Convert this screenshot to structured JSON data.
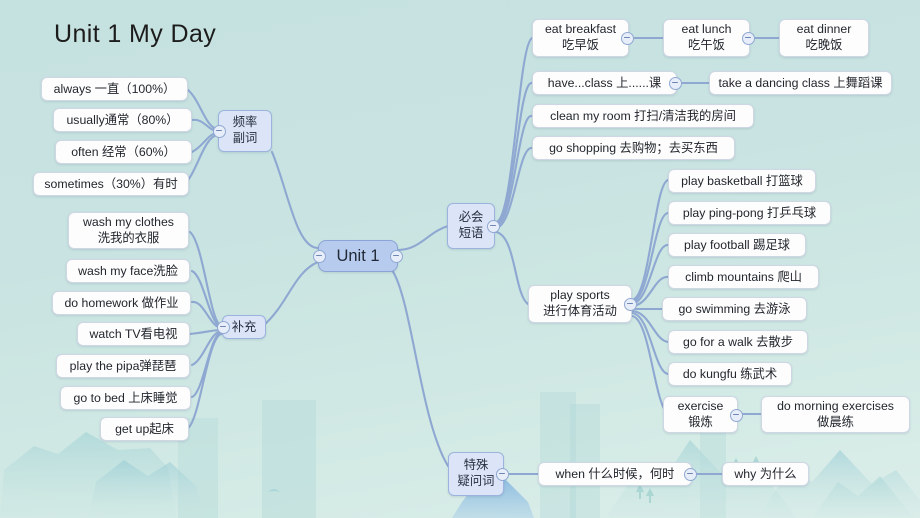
{
  "page": {
    "title": "Unit 1  My Day",
    "background_color": "#c6e2e0",
    "node_fill": "#fdfdfd",
    "branch_fill": "#dbe5f7",
    "root_fill": "#b7cbee",
    "connector_color": "#8fa8d2"
  },
  "root": {
    "label": "Unit 1"
  },
  "branches": {
    "frequency_adverbs": {
      "label_line1": "频率",
      "label_line2": "副词",
      "children": [
        {
          "text": "always  一直（100%）"
        },
        {
          "text": "usually通常（80%）"
        },
        {
          "text": "often 经常（60%）"
        },
        {
          "text": "sometimes（30%）有时"
        }
      ]
    },
    "supplement": {
      "label": "补充",
      "children": [
        {
          "line1": "wash my clothes",
          "line2": "洗我的衣服"
        },
        {
          "text": "wash my face洗脸"
        },
        {
          "text": "do homework 做作业"
        },
        {
          "text": "watch TV看电视"
        },
        {
          "text": "play the pipa弹琵琶"
        },
        {
          "text": "go to bed 上床睡觉"
        },
        {
          "text": "get  up起床"
        }
      ]
    },
    "must_know_phrases": {
      "label_line1": "必会",
      "label_line2": "短语",
      "children": [
        {
          "line1": "eat breakfast",
          "line2": "吃早饭",
          "sibling1": {
            "line1": "eat  lunch",
            "line2": "吃午饭"
          },
          "sibling2": {
            "line1": "eat dinner",
            "line2": "吃晚饭"
          }
        },
        {
          "text": "have...class 上......课",
          "sibling1": {
            "text": "take a dancing class 上舞蹈课"
          }
        },
        {
          "text": "clean my room 打扫/清洁我的房间"
        },
        {
          "text": "go shopping 去购物；去买东西"
        }
      ],
      "play_sports": {
        "line1": "play sports",
        "line2": "进行体育活动",
        "children": [
          {
            "text": "play  basketball 打篮球"
          },
          {
            "text": "play ping-pong 打乒乓球"
          },
          {
            "text": "play football 踢足球"
          },
          {
            "text": "climb mountains 爬山"
          },
          {
            "text": "go swimming 去游泳"
          },
          {
            "text": "go for a walk 去散步"
          },
          {
            "text": "do kungfu 练武术"
          },
          {
            "line1": "exercise",
            "line2": "锻炼",
            "sibling1": {
              "line1": "do morning exercises",
              "line2": "做晨练"
            }
          }
        ]
      }
    },
    "question_words": {
      "label_line1": "特殊",
      "label_line2": "疑问词",
      "children": [
        {
          "text": "when 什么时候，何时",
          "sibling1": {
            "text": "why 为什么"
          }
        }
      ]
    }
  }
}
